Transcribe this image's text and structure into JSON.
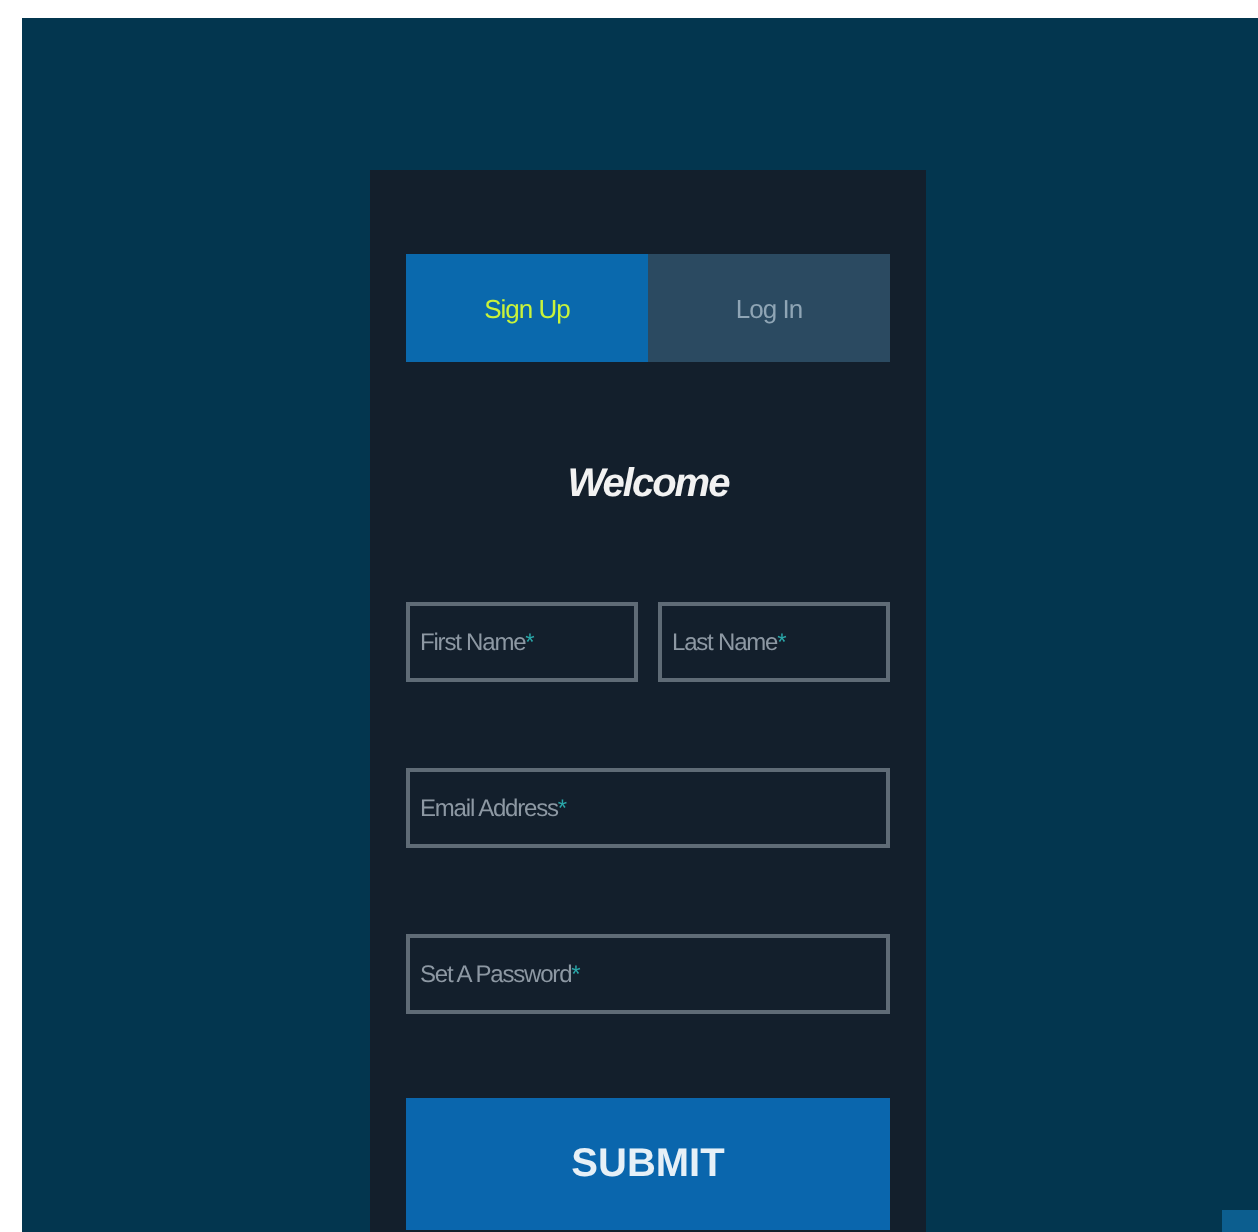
{
  "tabs": [
    {
      "label": "Sign Up",
      "selected": true
    },
    {
      "label": "Log In",
      "selected": false
    }
  ],
  "heading": "Welcome",
  "field_rows": [
    [
      {
        "label": "First Name",
        "required_mark": "*"
      },
      {
        "label": "Last Name",
        "required_mark": "*"
      }
    ],
    [
      {
        "label": "Email Address",
        "required_mark": "*"
      }
    ],
    [
      {
        "label": "Set A Password",
        "required_mark": "*"
      }
    ]
  ],
  "submit": "SUBMIT"
}
